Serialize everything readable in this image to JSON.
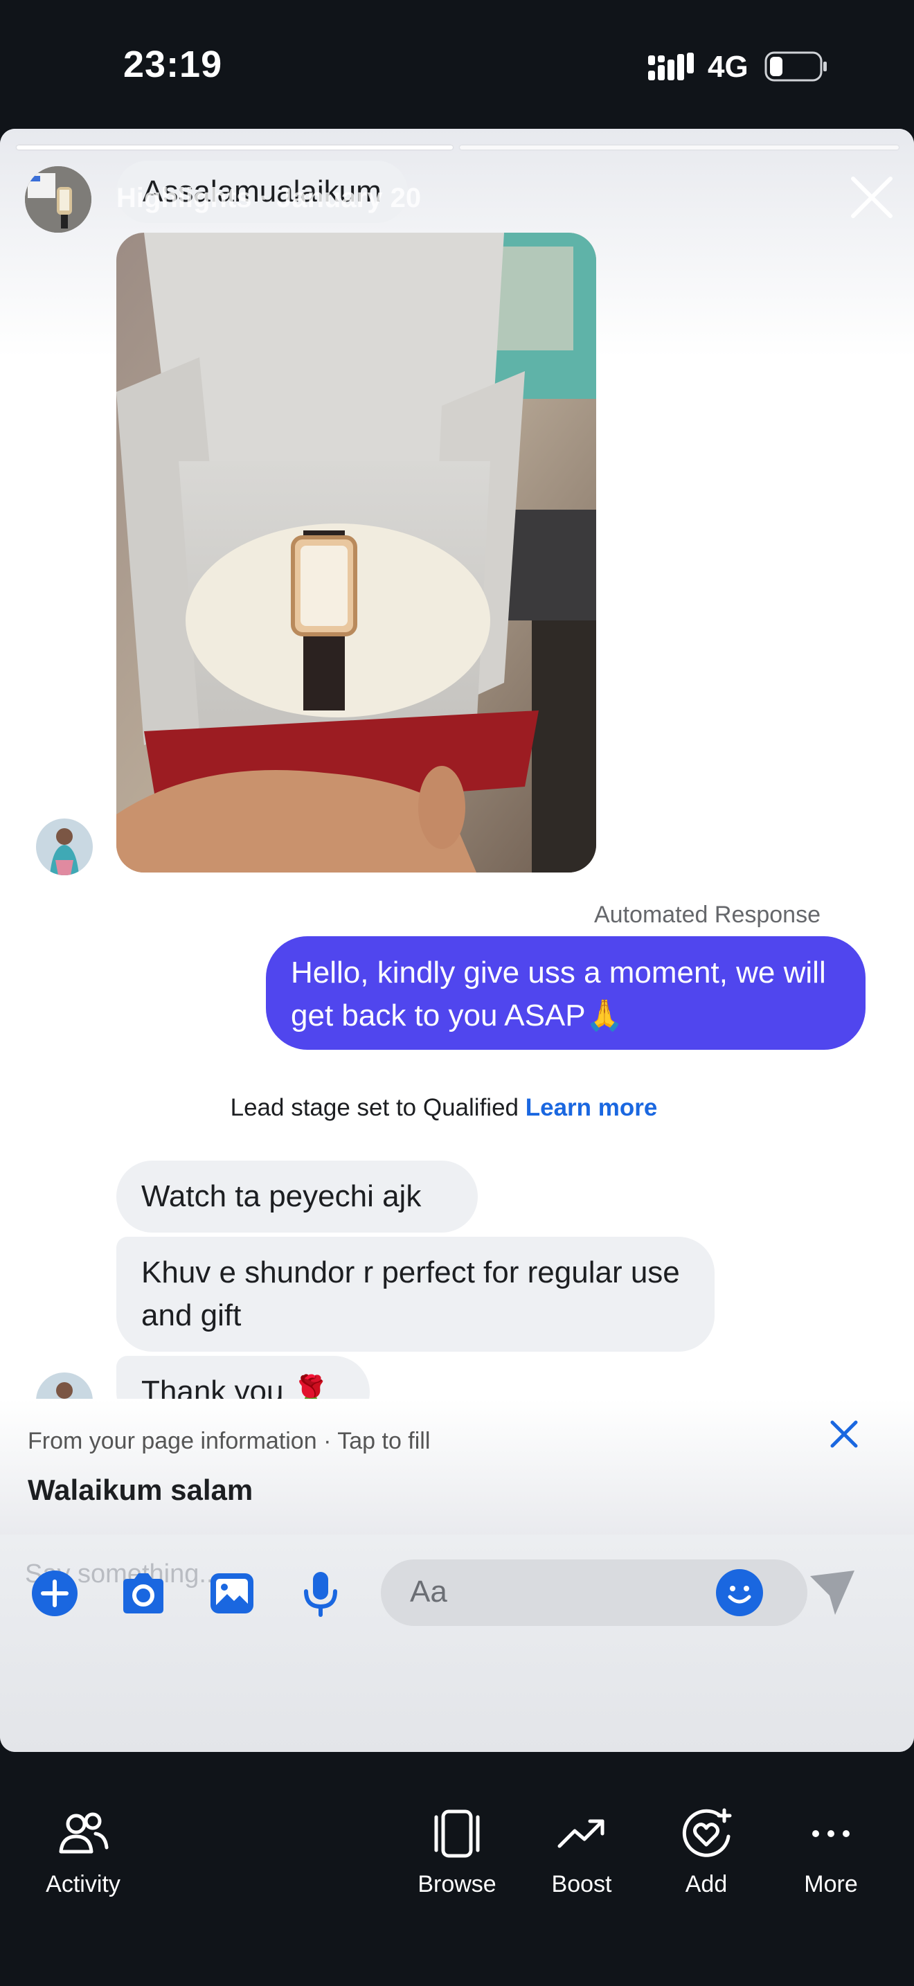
{
  "status_bar": {
    "time": "23:19",
    "network": "4G"
  },
  "story": {
    "header_text": "Highlights · January 20"
  },
  "conversation": {
    "greeting": "Assalamualaikum",
    "automated_label": "Automated Response",
    "sent_message": "Hello, kindly give uss a moment,  we will get back to you ASAP🙏",
    "lead_stage_text": "Lead stage set to Qualified",
    "lead_stage_link": "Learn more",
    "incoming": [
      "Watch ta peyechi ajk",
      "Khuv e shundor r perfect for regular use and gift",
      "Thank you 🌹"
    ]
  },
  "suggestion": {
    "hint": "From your page information · Tap to fill",
    "reply": "Walaikum salam"
  },
  "composer": {
    "story_placeholder": "Say something...",
    "input_placeholder": "Aa"
  },
  "bottom_nav": [
    {
      "label": "Activity",
      "icon": "people-icon"
    },
    {
      "label": "Browse",
      "icon": "browse-icon"
    },
    {
      "label": "Boost",
      "icon": "trend-up-icon"
    },
    {
      "label": "Add",
      "icon": "heart-add-icon"
    },
    {
      "label": "More",
      "icon": "more-dots-icon"
    }
  ],
  "colors": {
    "sent_bubble": "#5046ee",
    "link": "#1a67e0",
    "nav_bg": "#101419",
    "icon_blue": "#1a67e0"
  }
}
